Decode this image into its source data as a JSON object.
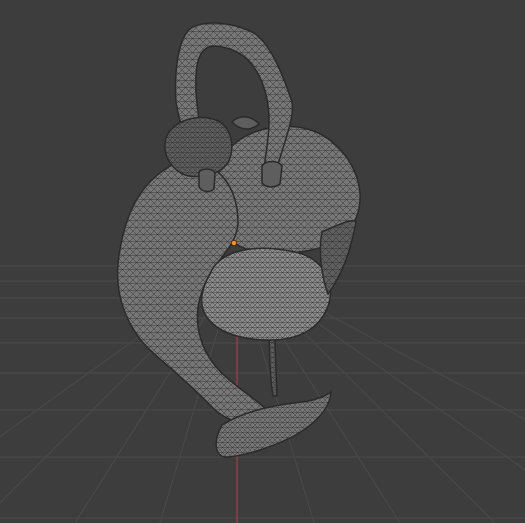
{
  "app": {
    "name": "3D viewport"
  },
  "viewport": {
    "background_color": "#3d3d3d",
    "grid_color": "#4a4a4a",
    "axis_color": "#a3414a",
    "mesh_color": "#777777",
    "wire_color": "#2a2a2a",
    "origin_color": "#ff8c1a",
    "shading": "solid-with-wireframe",
    "object": "sculpted-mesh"
  }
}
